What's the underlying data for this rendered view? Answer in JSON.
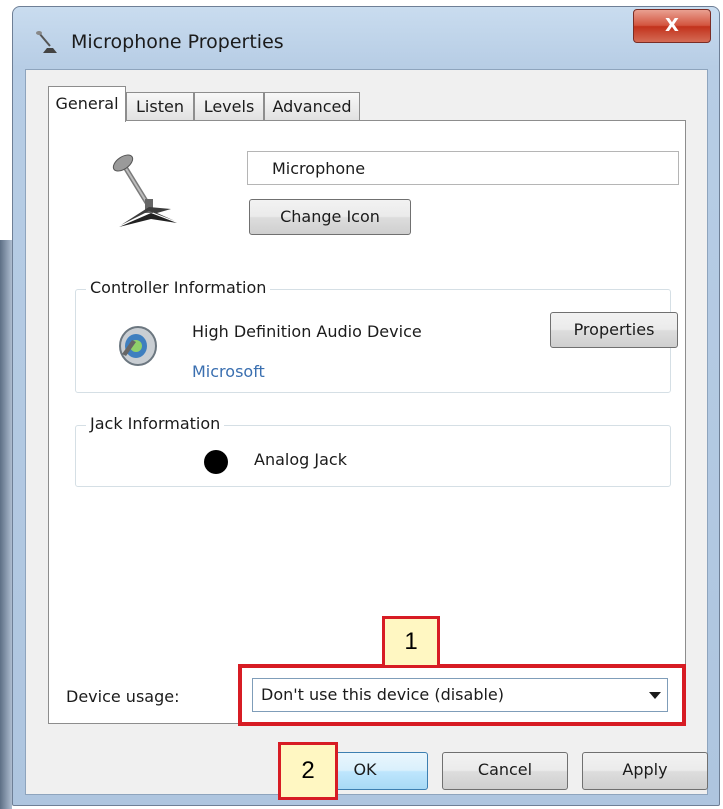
{
  "window": {
    "title": "Microphone Properties",
    "close_label": "X"
  },
  "tabs": [
    {
      "label": "General",
      "active": true
    },
    {
      "label": "Listen",
      "active": false
    },
    {
      "label": "Levels",
      "active": false
    },
    {
      "label": "Advanced",
      "active": false
    }
  ],
  "general": {
    "device_name": "Microphone",
    "change_icon_button": "Change Icon",
    "controller": {
      "group_label": "Controller Information",
      "device": "High Definition Audio Device",
      "vendor": "Microsoft",
      "properties_button": "Properties"
    },
    "jack": {
      "group_label": "Jack Information",
      "jack_name": "Analog Jack"
    },
    "device_usage": {
      "label": "Device usage:",
      "selected": "Don't use this device (disable)"
    }
  },
  "buttons": {
    "ok": "OK",
    "cancel": "Cancel",
    "apply": "Apply"
  },
  "annotations": {
    "callout_1": "1",
    "callout_2": "2",
    "highlight_color": "#d71c24",
    "callout_fill": "#fff7c2"
  }
}
